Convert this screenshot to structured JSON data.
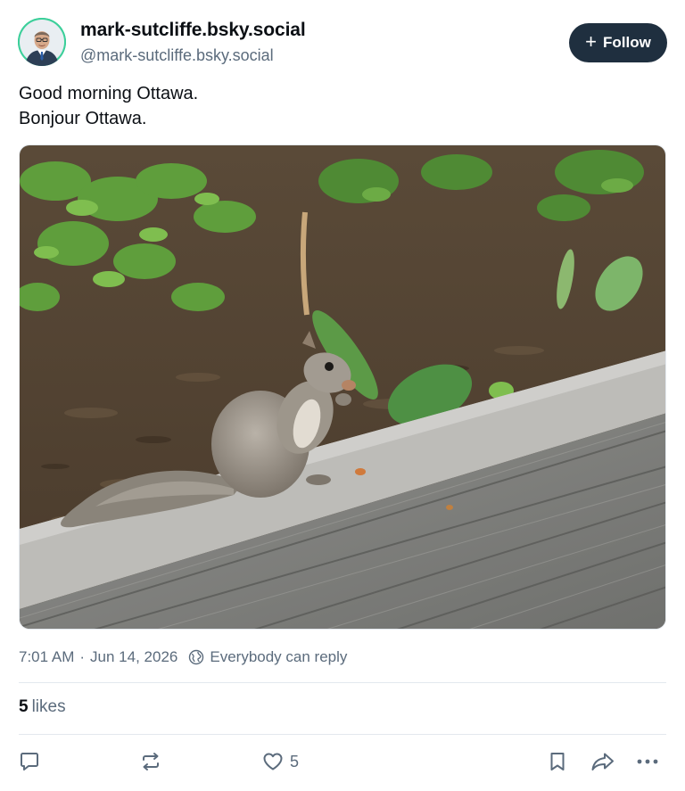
{
  "author": {
    "display_name": "mark-sutcliffe.bsky.social",
    "handle": "@mark-sutcliffe.bsky.social",
    "avatar_bg": "#3ccf9a"
  },
  "follow": {
    "icon": "plus-icon",
    "label": "Follow"
  },
  "post": {
    "lines": [
      "Good morning Ottawa.",
      "Bonjour Ottawa."
    ]
  },
  "meta": {
    "time": "7:01 AM",
    "separator": "·",
    "date": "Jun 14, 2026",
    "reply_icon": "globe-icon",
    "reply_setting": "Everybody can reply"
  },
  "stats": {
    "likes_count": "5",
    "likes_label": "likes"
  },
  "actions": {
    "reply_icon": "reply-bubble-icon",
    "repost_icon": "repost-icon",
    "like_icon": "heart-icon",
    "like_count": "5",
    "bookmark_icon": "bookmark-icon",
    "share_icon": "share-arrow-icon",
    "more_icon": "more-dots-icon"
  },
  "colors": {
    "accent_dark": "#1f2f3f",
    "muted_text": "#5b6b7c",
    "divider": "#e3e8ee"
  }
}
